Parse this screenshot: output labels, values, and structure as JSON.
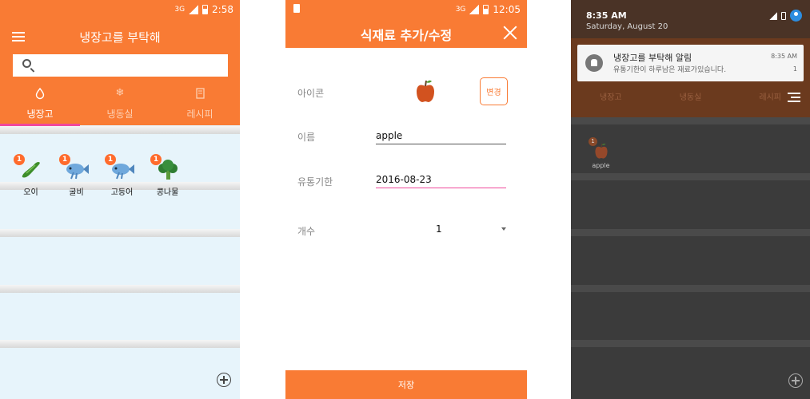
{
  "screen1": {
    "status": {
      "network": "3G",
      "time": "2:58"
    },
    "app_title": "냉장고를 부탁해",
    "search": {
      "placeholder": ""
    },
    "tabs": [
      {
        "label": "냉장고",
        "icon": "water-drop-icon",
        "selected": true
      },
      {
        "label": "냉동실",
        "icon": "snowflake-icon",
        "selected": false
      },
      {
        "label": "레시피",
        "icon": "recipe-book-icon",
        "selected": false
      }
    ],
    "items": [
      {
        "name": "오이",
        "badge": "1",
        "icon": "cucumber-icon"
      },
      {
        "name": "굴비",
        "badge": "1",
        "icon": "fish-icon"
      },
      {
        "name": "고등어",
        "badge": "1",
        "icon": "fish-icon"
      },
      {
        "name": "콩나물",
        "badge": "1",
        "icon": "broccoli-icon"
      }
    ],
    "colors": {
      "accent": "#f97b34",
      "tab_indicator": "#f0489c",
      "shelf_bg": "#e7f4fb"
    }
  },
  "screen2": {
    "status": {
      "network": "3G",
      "time": "12:05"
    },
    "dialog_title": "식재료 추가/수정",
    "icon_label": "아이콘",
    "icon_image": "apple-icon",
    "change_button": "변경",
    "name_label": "이름",
    "name_value": "apple",
    "expiry_label": "유통기한",
    "expiry_value": "2016-08-23",
    "count_label": "개수",
    "count_value": "1",
    "save_button": "저장"
  },
  "screen3": {
    "time": "8:35 AM",
    "date": "Saturday, August 20",
    "notification": {
      "title": "냉장고를 부탁해 알림",
      "text": "유통기한이 하루남은 재료가있습니다.",
      "time": "8:35 AM",
      "count": "1"
    },
    "tabs": [
      "냉장고",
      "냉동실",
      "레시피"
    ],
    "item": {
      "name": "apple",
      "badge": "1",
      "icon": "apple-icon"
    }
  }
}
